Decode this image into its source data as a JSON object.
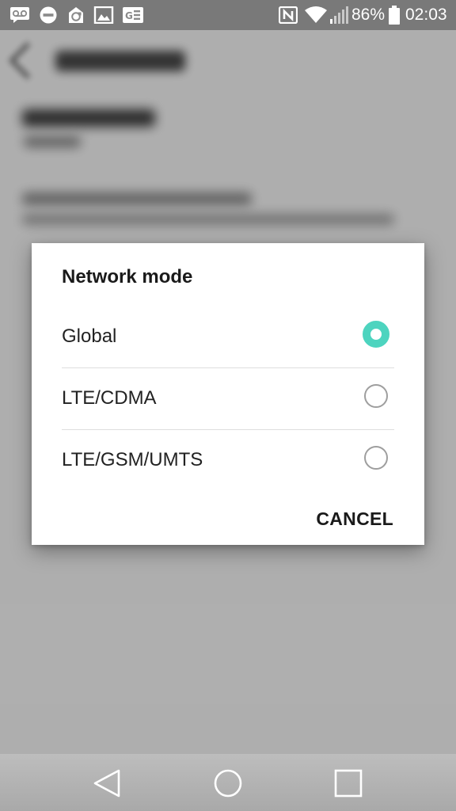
{
  "status_bar": {
    "battery_percent": "86%",
    "time": "02:03",
    "icons": [
      "voicemail-icon",
      "dnd-icon",
      "sync-icon",
      "gallery-icon",
      "ge-icon",
      "nfc-icon",
      "wifi-icon",
      "signal-icon",
      "battery-icon"
    ]
  },
  "dialog": {
    "title": "Network mode",
    "options": [
      {
        "label": "Global",
        "selected": true
      },
      {
        "label": "LTE/CDMA",
        "selected": false
      },
      {
        "label": "LTE/GSM/UMTS",
        "selected": false
      }
    ],
    "cancel_label": "CANCEL"
  },
  "colors": {
    "accent": "#4dd4bf",
    "scrim": "rgba(0,0,0,0.30)"
  },
  "nav_bar": {
    "icons": [
      "back-icon",
      "home-icon",
      "recents-icon"
    ]
  }
}
